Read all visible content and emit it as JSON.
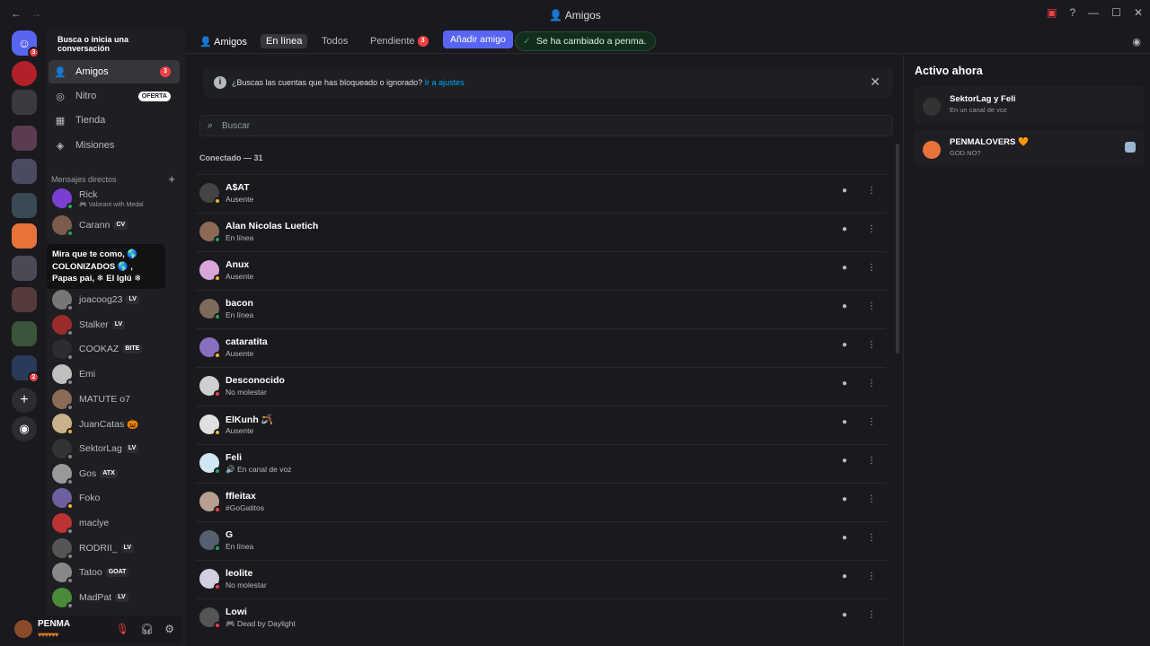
{
  "window": {
    "title": "Amigos",
    "back_icon": "arrow-left-icon",
    "forward_icon": "arrow-right-icon"
  },
  "sidebar": {
    "search_label": "Busca o inicia una conversación",
    "nav": [
      {
        "label": "Amigos",
        "icon": "people-icon",
        "badge": "3"
      },
      {
        "label": "Nitro",
        "icon": "nitro-icon",
        "badge": "OFERTA"
      },
      {
        "label": "Tienda",
        "icon": "shop-icon"
      },
      {
        "label": "Misiones",
        "icon": "quest-icon"
      }
    ],
    "dm_header": "Mensajes directos",
    "dms": [
      {
        "name": "Rick",
        "sub": "🎮 Valorant with Medal",
        "tag": "",
        "color": "#7a3fd1",
        "status": "#23a55a"
      },
      {
        "name": "Carann",
        "sub": "",
        "tag": "CV",
        "color": "#7a5b4c",
        "status": "#23a55a"
      },
      {
        "name": "joacoog23",
        "sub": "",
        "tag": "LV",
        "color": "#777",
        "status": "#80848e"
      },
      {
        "name": "Stalker",
        "sub": "",
        "tag": "LV",
        "color": "#9a2b2b",
        "status": "#80848e"
      },
      {
        "name": "COOKAZ",
        "sub": "",
        "tag": "BITE",
        "color": "#2b2d31",
        "status": "#80848e"
      },
      {
        "name": "Emi",
        "sub": "",
        "tag": "",
        "color": "#bfbfbf",
        "status": "#80848e"
      },
      {
        "name": "MATUTE o7",
        "sub": "",
        "tag": "",
        "color": "#8b6b55",
        "status": "#80848e"
      },
      {
        "name": "JuanCatas 🎃",
        "sub": "",
        "tag": "",
        "color": "#c9b28a",
        "status": "#f0b232"
      },
      {
        "name": "SektorLag",
        "sub": "",
        "tag": "LV",
        "color": "#333",
        "status": "#80848e"
      },
      {
        "name": "Gos",
        "sub": "",
        "tag": "ATX",
        "color": "#999",
        "status": "#80848e"
      },
      {
        "name": "Foko",
        "sub": "",
        "tag": "",
        "color": "#6f5fa0",
        "status": "#f0b232"
      },
      {
        "name": "maclye",
        "sub": "",
        "tag": "",
        "color": "#b33",
        "status": "#80848e"
      },
      {
        "name": "RODRII_",
        "sub": "",
        "tag": "LV",
        "color": "#555",
        "status": "#80848e"
      },
      {
        "name": "Tatoo",
        "sub": "",
        "tag": "GOAT",
        "color": "#888",
        "status": "#80848e"
      },
      {
        "name": "MadPat",
        "sub": "",
        "tag": "LV",
        "color": "#4a8a3a",
        "status": "#80848e"
      }
    ],
    "tooltip": "Mira que te como, 🌎 COLONIZADOS 🌎 , Papas pai, ❄ El Iglú ❄"
  },
  "user": {
    "name": "PENMA",
    "status": "♥♥♥♥♥♥",
    "mic_icon": "mic-muted-icon",
    "headset_icon": "headset-icon",
    "settings_icon": "gear-icon"
  },
  "topbar": {
    "title": "Amigos",
    "tabs": [
      {
        "label": "En línea"
      },
      {
        "label": "Todos"
      },
      {
        "label": "Pendiente",
        "badge": "3"
      }
    ],
    "add_friend": "Añadir amigo",
    "toast": "Se ha cambiado a penma."
  },
  "notice": {
    "text": "¿Buscas las cuentas que has bloqueado o ignorado?",
    "link": "Ir a ajustes"
  },
  "search": {
    "placeholder": "Buscar"
  },
  "section_title": "Conectado — 31",
  "friends": [
    {
      "name": "A$AT",
      "status": "Ausente",
      "color": "#444",
      "dot": "#f0b232"
    },
    {
      "name": "Alan Nicolas Luetich",
      "status": "En línea",
      "color": "#8c6a55",
      "dot": "#23a55a"
    },
    {
      "name": "Anux",
      "status": "Ausente",
      "color": "#d9a6d9",
      "dot": "#f0b232"
    },
    {
      "name": "bacon",
      "status": "En línea",
      "color": "#7c6a5a",
      "dot": "#23a55a"
    },
    {
      "name": "cataratita",
      "status": "Ausente",
      "color": "#8a6fc0",
      "dot": "#f0b232"
    },
    {
      "name": "Desconocido",
      "status": "No molestar",
      "color": "#cfcfcf",
      "dot": "#f23f42"
    },
    {
      "name": "ElKunh 🪃",
      "status": "Ausente",
      "color": "#e0e0e0",
      "dot": "#f0b232"
    },
    {
      "name": "Feli",
      "status": "🔊 En canal de voz",
      "color": "#cfe6f5",
      "dot": "#23a55a"
    },
    {
      "name": "ffleitax",
      "status": "#GoGatitos",
      "color": "#b5a090",
      "dot": "#f23f42"
    },
    {
      "name": "G",
      "status": "En línea",
      "color": "#556070",
      "dot": "#23a55a"
    },
    {
      "name": "leolite",
      "status": "No molestar",
      "color": "#d0d0e0",
      "dot": "#f23f42"
    },
    {
      "name": "Lowi",
      "status": "🎮 Dead by Daylight",
      "color": "#555",
      "dot": "#f23f42"
    }
  ],
  "active_now": {
    "title": "Activo ahora",
    "cards": [
      {
        "name": "SektorLag y Feli",
        "sub": "En un canal de voz"
      },
      {
        "name": "PENMALOVERS 🧡",
        "sub": "GOD NO?"
      }
    ]
  },
  "colors": {
    "accent": "#5865f2",
    "online": "#23a55a",
    "idle": "#f0b232",
    "dnd": "#f23f42"
  }
}
